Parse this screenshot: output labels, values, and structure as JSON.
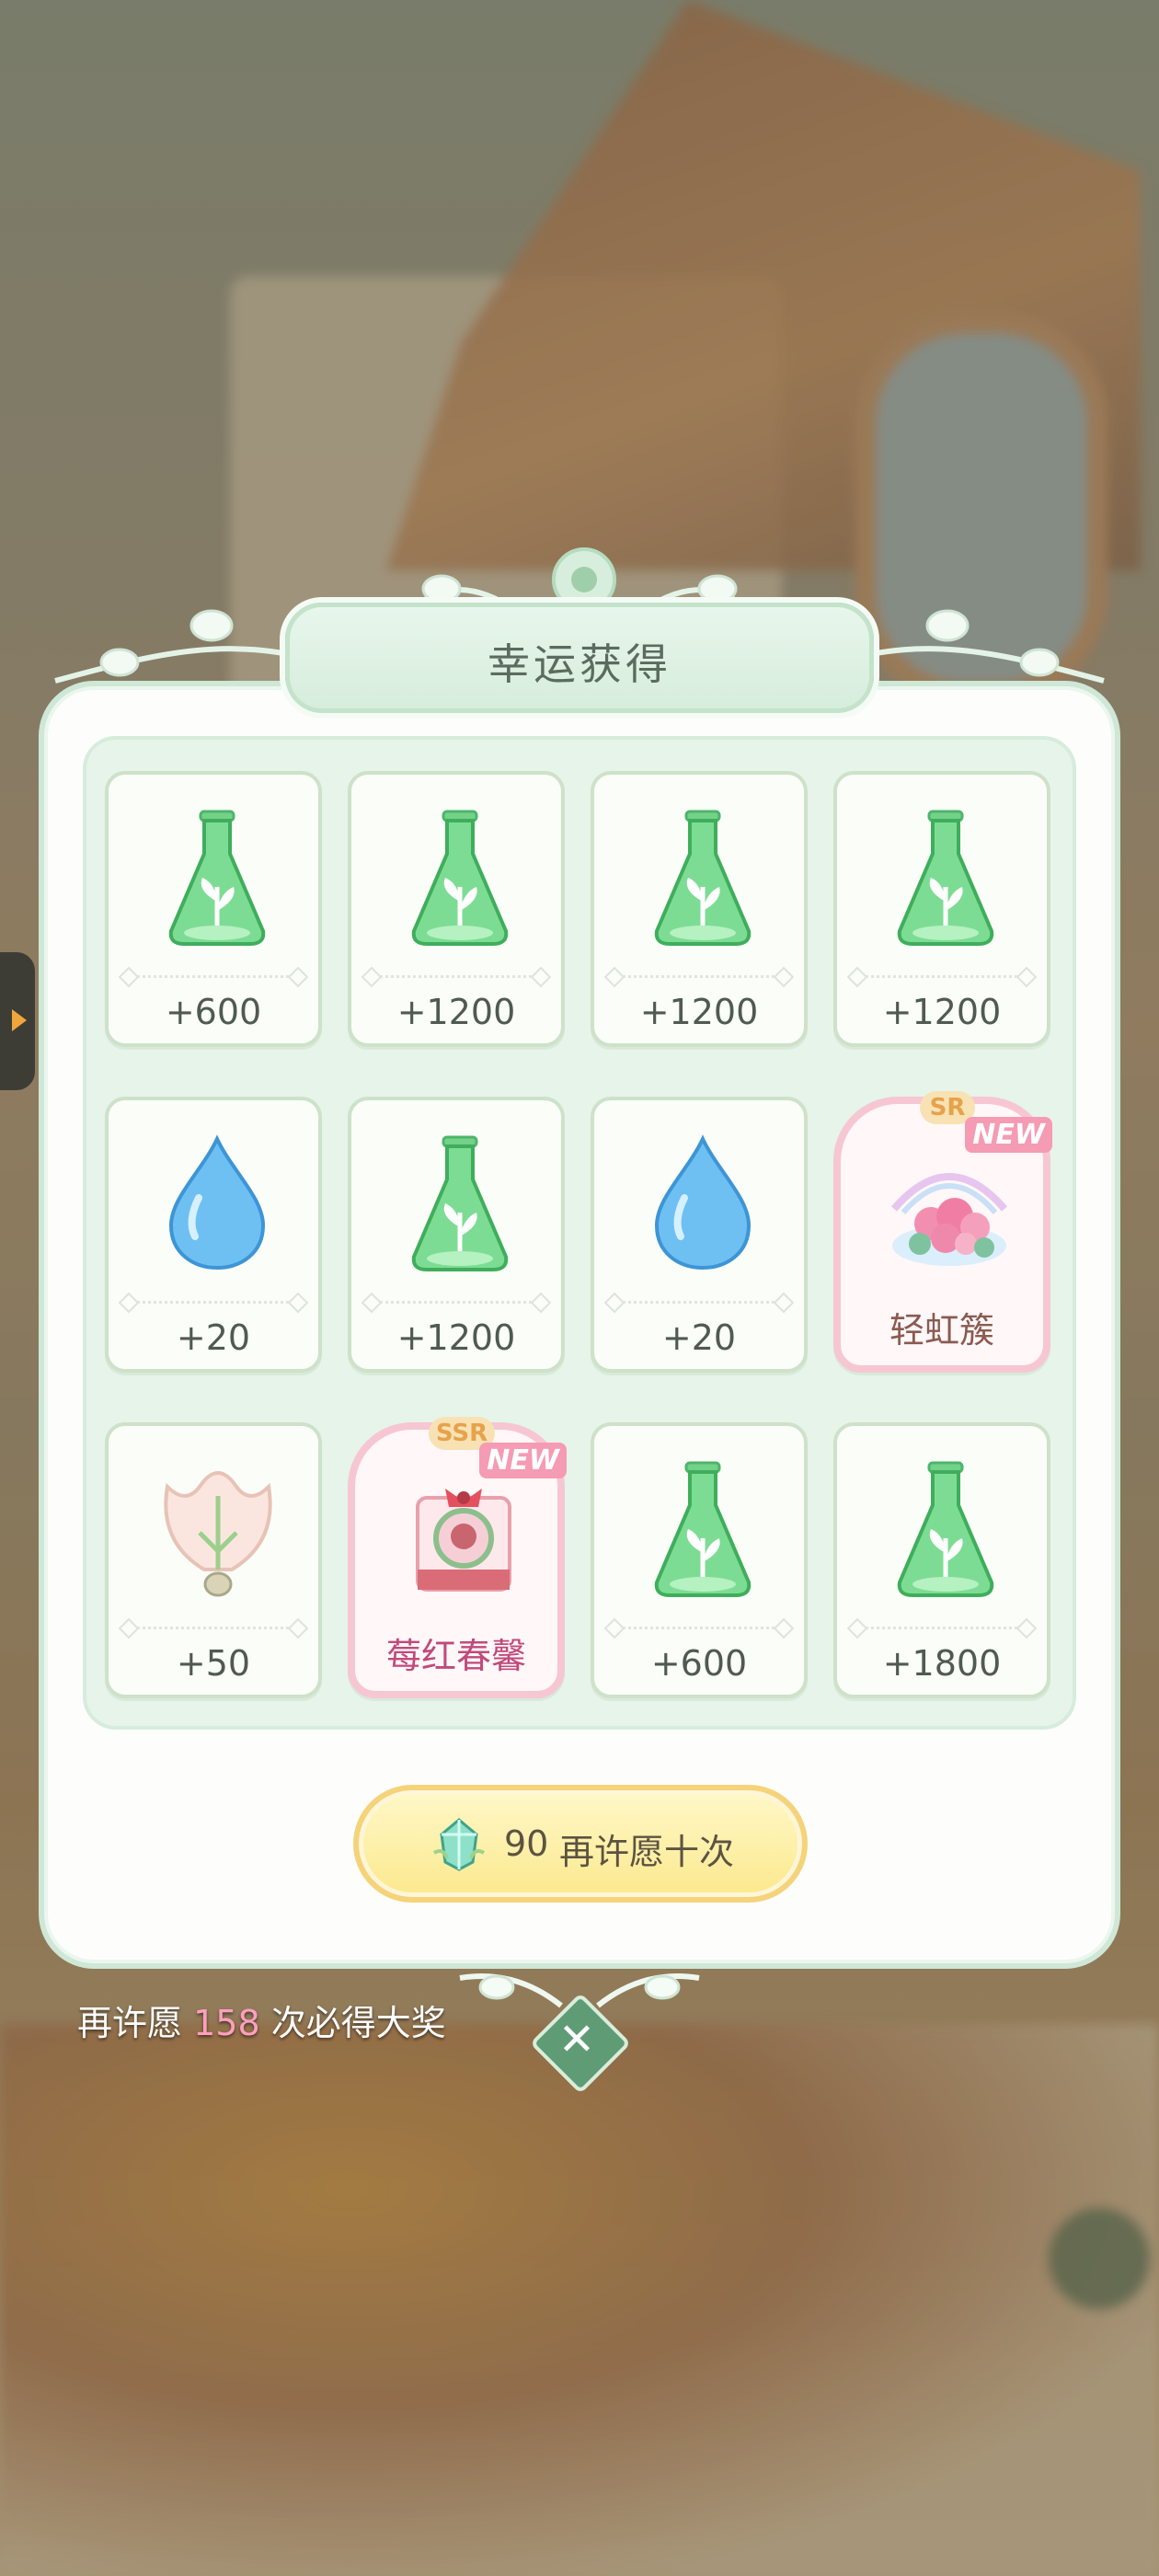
{
  "dialog": {
    "title": "幸运获得",
    "items": [
      {
        "type": "flask",
        "amount": "+600"
      },
      {
        "type": "flask",
        "amount": "+1200"
      },
      {
        "type": "flask",
        "amount": "+1200"
      },
      {
        "type": "flask",
        "amount": "+1200"
      },
      {
        "type": "water-drop",
        "amount": "+20"
      },
      {
        "type": "flask",
        "amount": "+1200"
      },
      {
        "type": "water-drop",
        "amount": "+20"
      },
      {
        "type": "outfit",
        "rarity": "SR",
        "tag": "NEW",
        "name": "轻虹簇"
      },
      {
        "type": "petal",
        "amount": "+50"
      },
      {
        "type": "outfit",
        "rarity": "SSR",
        "tag": "NEW",
        "name": "莓红春馨"
      },
      {
        "type": "flask",
        "amount": "+600"
      },
      {
        "type": "flask",
        "amount": "+1800"
      }
    ],
    "wish_again": {
      "cost": "90",
      "label": "再许愿十次"
    },
    "pity": {
      "prefix": "再许愿",
      "count": "158",
      "suffix": "次必得大奖"
    },
    "close_icon": "close-icon"
  },
  "colors": {
    "panel_border": "#cfe7d6",
    "flask_green": "#6fd38a",
    "drop_blue": "#6ec0f2",
    "ssr_pink": "#f6c7d2",
    "button_gold": "#f5d37a",
    "pity_number": "#ff9fc0"
  }
}
